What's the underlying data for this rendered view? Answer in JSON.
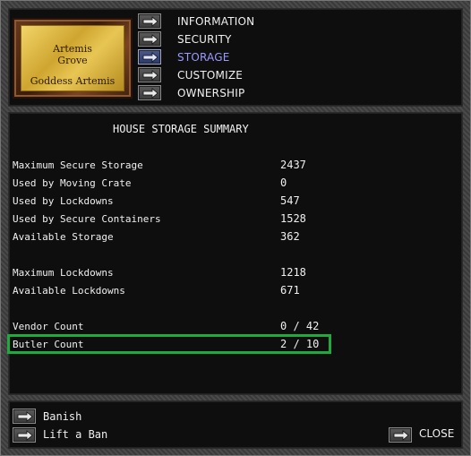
{
  "plaque": {
    "line1": "Artemis",
    "line2": "Grove",
    "line3": "Goddess Artemis"
  },
  "nav": {
    "items": [
      {
        "label": "INFORMATION",
        "active": false
      },
      {
        "label": "SECURITY",
        "active": false
      },
      {
        "label": "STORAGE",
        "active": true
      },
      {
        "label": "CUSTOMIZE",
        "active": false
      },
      {
        "label": "OWNERSHIP",
        "active": false
      }
    ]
  },
  "summary": {
    "title": "HOUSE STORAGE SUMMARY",
    "rows": [
      {
        "label": "Maximum Secure Storage",
        "value": "2437"
      },
      {
        "label": "Used by Moving Crate",
        "value": "0"
      },
      {
        "label": "Used by Lockdowns",
        "value": "547"
      },
      {
        "label": "Used by Secure Containers",
        "value": "1528"
      },
      {
        "label": "Available Storage",
        "value": "362"
      },
      {
        "label": "Maximum Lockdowns",
        "value": "1218"
      },
      {
        "label": "Available Lockdowns",
        "value": "671"
      },
      {
        "label": "Vendor Count",
        "value": "0 / 42"
      },
      {
        "label": "Butler Count",
        "value": "2 / 10"
      }
    ]
  },
  "actions": {
    "banish": "Banish",
    "lift_ban": "Lift a Ban",
    "close": "CLOSE"
  },
  "colors": {
    "highlight": "#1eaa3c",
    "active_nav": "#9a9aff"
  }
}
